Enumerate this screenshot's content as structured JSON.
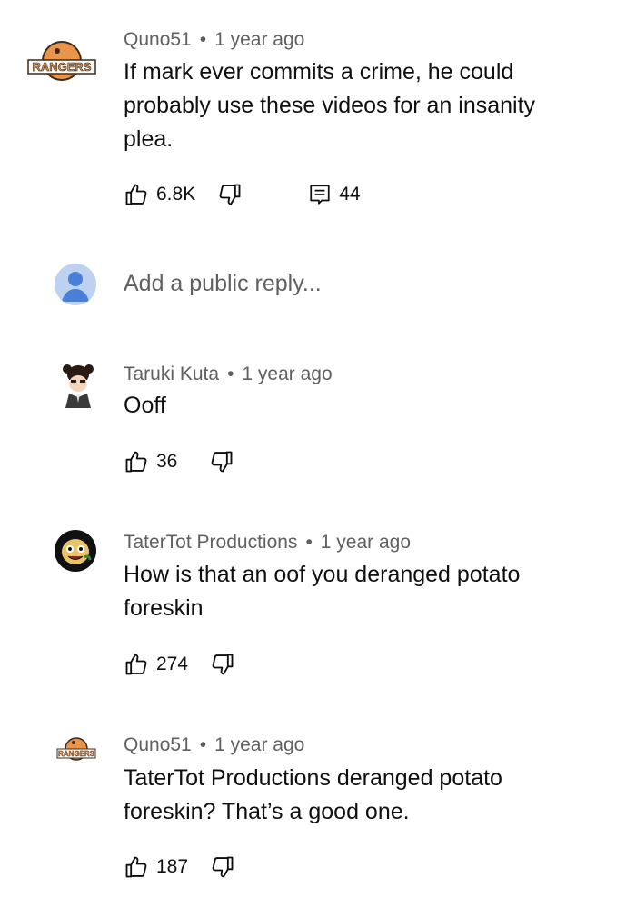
{
  "comments": [
    {
      "author": "Quno51",
      "time": "1 year ago",
      "text": "If mark ever commits a crime, he could probably use these videos for an insanity plea.",
      "likes": "6.8K",
      "replies": "44",
      "avatar_label": "RANGERS",
      "avatar_icon": "rangers-logo-icon"
    },
    {
      "author": "Taruki Kuta",
      "time": "1 year ago",
      "text": "Ooff",
      "likes": "36",
      "avatar_icon": "character-avatar-icon"
    },
    {
      "author": "TaterTot Productions",
      "time": "1 year ago",
      "text": "How is that an oof you deranged potato foreskin",
      "likes": "274",
      "avatar_icon": "tatertot-avatar-icon"
    },
    {
      "author": "Quno51",
      "time": "1 year ago",
      "text": "TaterTot Productions deranged potato foreskin? That’s a good one.",
      "likes": "187",
      "avatar_label": "RANGERS",
      "avatar_icon": "rangers-logo-icon"
    }
  ],
  "reply": {
    "placeholder": "Add a public reply..."
  },
  "colors": {
    "meta_text": "#606060",
    "rangers_orange": "#e8944a",
    "user_avatar_bg": "#bcd2f0",
    "user_avatar_fg": "#4a7fd8"
  },
  "separator": "•"
}
